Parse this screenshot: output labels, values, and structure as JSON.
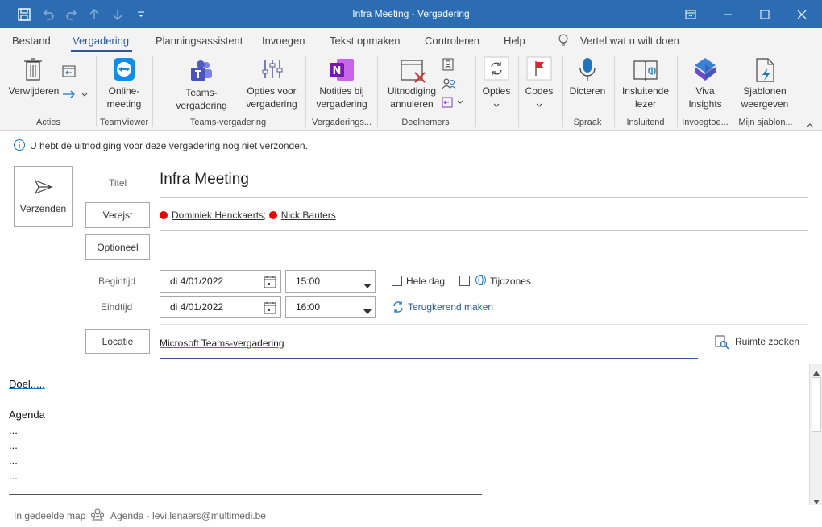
{
  "window": {
    "title": "Infra Meeting  -  Vergadering"
  },
  "tabs": [
    {
      "label": "Bestand"
    },
    {
      "label": "Vergadering"
    },
    {
      "label": "Planningsassistent"
    },
    {
      "label": "Invoegen"
    },
    {
      "label": "Tekst opmaken"
    },
    {
      "label": "Controleren"
    },
    {
      "label": "Help"
    }
  ],
  "tell_me": "Vertel wat u wilt doen",
  "ribbon": {
    "delete": "Verwijderen",
    "online_meeting_1": "Online-",
    "online_meeting_2": "meeting",
    "teams_meeting_1": "Teams-",
    "teams_meeting_2": "vergadering",
    "meeting_options_1": "Opties voor",
    "meeting_options_2": "vergadering",
    "notes_1": "Notities bij",
    "notes_2": "vergadering",
    "cancel_1": "Uitnodiging",
    "cancel_2": "annuleren",
    "options": "Opties",
    "codes": "Codes",
    "dictate": "Dicteren",
    "reader_1": "Insluitende",
    "reader_2": "lezer",
    "viva_1": "Viva",
    "viva_2": "Insights",
    "templates_1": "Sjablonen",
    "templates_2": "weergeven",
    "groups": {
      "acties": "Acties",
      "teamviewer": "TeamViewer",
      "teams": "Teams-vergadering",
      "notes": "Vergaderings...",
      "attendees": "Deelnemers",
      "speech": "Spraak",
      "immersive": "Insluitend",
      "addins": "Invoegtoe...",
      "templates": "Mijn sjablon..."
    }
  },
  "info": "U hebt de uitnodiging voor deze vergadering nog niet verzonden.",
  "form": {
    "send": "Verzenden",
    "title_label": "Titel",
    "title_value": "Infra Meeting",
    "required_btn": "Verejst",
    "required": [
      "Dominiek Henckaerts",
      "Nick Bauters"
    ],
    "optional_btn": "Optioneel",
    "start_label": "Begintijd",
    "end_label": "Eindtijd",
    "start_date": "di 4/01/2022",
    "start_time": "15:00",
    "end_date": "di 4/01/2022",
    "end_time": "16:00",
    "all_day": "Hele dag",
    "timezones": "Tijdzones",
    "recurring": "Terugkerend maken",
    "location_btn": "Locatie",
    "location_value": "Microsoft Teams-vergadering",
    "room_finder": "Ruimte zoeken"
  },
  "body": {
    "line1": "Doel.....",
    "line2": "Agenda",
    "dots": [
      "...",
      "...",
      "...",
      "..."
    ]
  },
  "status": {
    "shared": "In gedeelde map",
    "calendar": "Agenda - levi.lenaers@multimedi.be"
  },
  "colors": {
    "titlebar": "#2b6cb3",
    "accent": "#2b579a",
    "attendee_dot": "#e00000"
  }
}
